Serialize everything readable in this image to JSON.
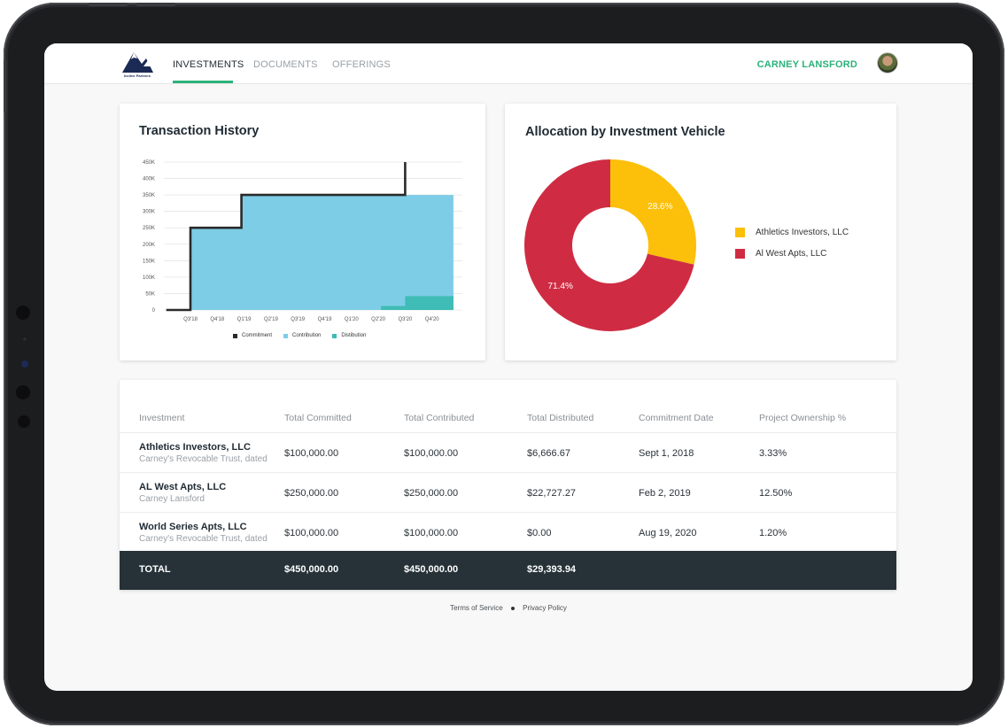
{
  "brand": {
    "logo_text": "Incline Partners",
    "logo_icon": "mountain-logo-icon",
    "color": "#1b2a55"
  },
  "nav": {
    "tabs": [
      {
        "label": "INVESTMENTS",
        "active": true
      },
      {
        "label": "DOCUMENTS",
        "active": false
      },
      {
        "label": "OFFERINGS",
        "active": false
      }
    ],
    "user_name": "CARNEY LANSFORD",
    "accent_color": "#2bb27a"
  },
  "transaction_history": {
    "title": "Transaction History",
    "chart_data": {
      "type": "area",
      "title": "Transaction History",
      "categories": [
        "Q3'18",
        "Q4'18",
        "Q1'19",
        "Q2'19",
        "Q3'19",
        "Q4'19",
        "Q1'20",
        "Q2'20",
        "Q3'20",
        "Q4'20"
      ],
      "y_ticks": [
        "0",
        "50K",
        "100K",
        "150K",
        "200K",
        "250K",
        "300K",
        "350K",
        "400K",
        "450K"
      ],
      "ylim": [
        0,
        450000
      ],
      "grid": true,
      "legend": "bottom",
      "series": [
        {
          "name": "Commitment",
          "style": "step-line",
          "color": "#2a2a2a",
          "points": [
            [
              -0.9,
              0
            ],
            [
              0,
              0
            ],
            [
              0,
              250000
            ],
            [
              1.9,
              250000
            ],
            [
              1.9,
              350000
            ],
            [
              8,
              350000
            ],
            [
              8,
              450000
            ]
          ]
        },
        {
          "name": "Contribution",
          "style": "step-area",
          "color": "#7ecde6",
          "points": [
            [
              0,
              250000
            ],
            [
              1.9,
              250000
            ],
            [
              1.9,
              350000
            ],
            [
              9.8,
              350000
            ]
          ]
        },
        {
          "name": "Distibution",
          "style": "step-area",
          "color": "#3fbcb5",
          "points": [
            [
              7.1,
              12000
            ],
            [
              8,
              12000
            ],
            [
              8,
              42000
            ],
            [
              9.8,
              42000
            ]
          ]
        }
      ]
    }
  },
  "allocation": {
    "title": "Allocation by Investment Vehicle",
    "chart_data": {
      "type": "pie",
      "title": "Allocation by Investment Vehicle",
      "legend": "right",
      "slices": [
        {
          "name": "Athletics Investors, LLC",
          "value": 28.6,
          "label": "28.6%",
          "color": "#fcbf0a"
        },
        {
          "name": "Al West Apts, LLC",
          "value": 71.4,
          "label": "71.4%",
          "color": "#cf2c43"
        }
      ]
    }
  },
  "table": {
    "headers": [
      "Investment",
      "Total Committed",
      "Total Contributed",
      "Total Distributed",
      "Commitment Date",
      "Project Ownership %"
    ],
    "rows": [
      {
        "name": "Athletics Investors, LLC",
        "sub": "Carney's Revocable Trust, dated",
        "committed": "$100,000.00",
        "contributed": "$100,000.00",
        "distributed": "$6,666.67",
        "date": "Sept 1, 2018",
        "ownership": "3.33%"
      },
      {
        "name": "AL West Apts, LLC",
        "sub": "Carney Lansford",
        "committed": "$250,000.00",
        "contributed": "$250,000.00",
        "distributed": "$22,727.27",
        "date": "Feb 2, 2019",
        "ownership": "12.50%"
      },
      {
        "name": "World Series Apts, LLC",
        "sub": "Carney's Revocable Trust, dated",
        "committed": "$100,000.00",
        "contributed": "$100,000.00",
        "distributed": "$0.00",
        "date": "Aug 19, 2020",
        "ownership": "1.20%"
      }
    ],
    "total": {
      "label": "TOTAL",
      "committed": "$450,000.00",
      "contributed": "$450,000.00",
      "distributed": "$29,393.94"
    }
  },
  "footer": {
    "terms": "Terms of Service",
    "privacy": "Privacy Policy"
  }
}
